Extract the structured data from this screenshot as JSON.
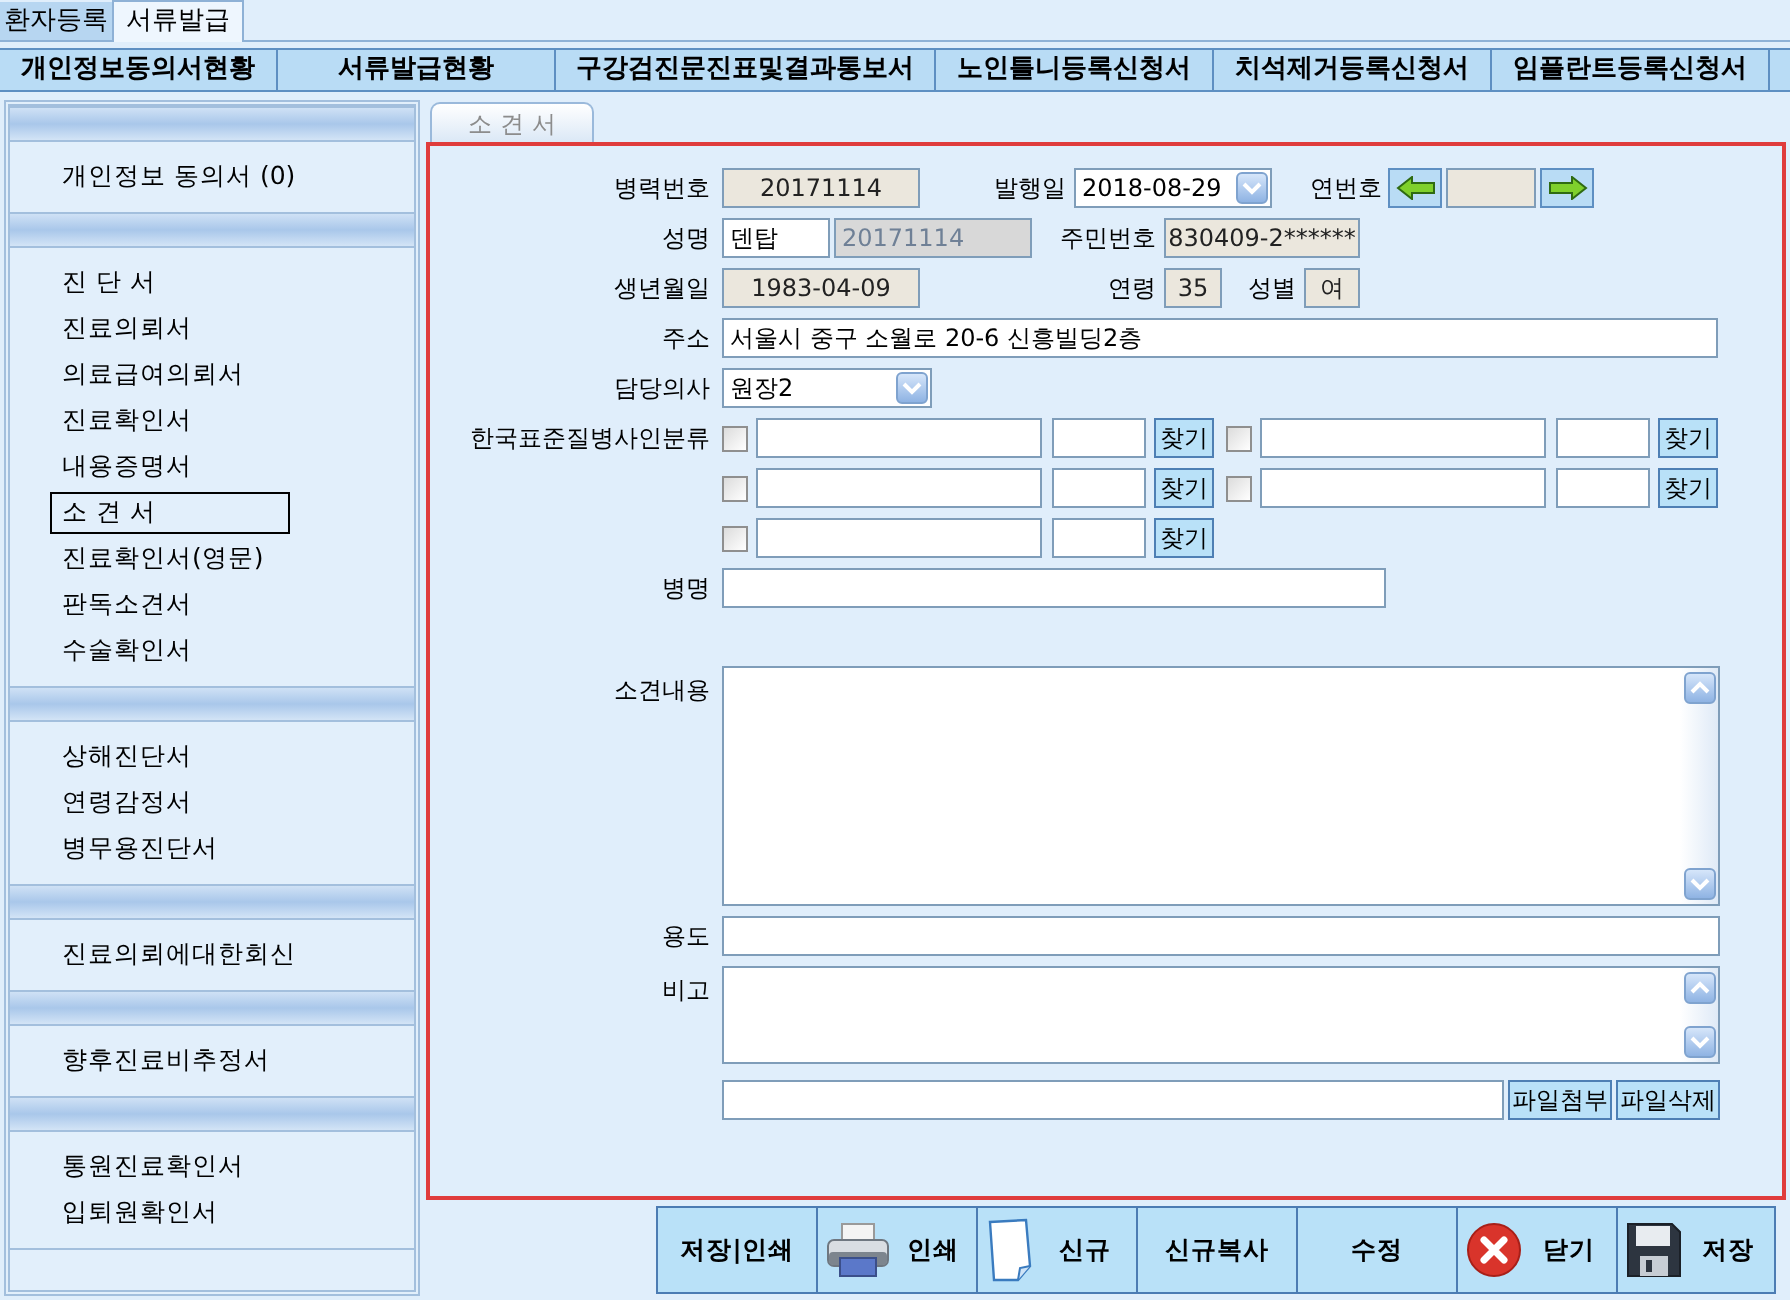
{
  "top_tabs": [
    {
      "label": "환자등록",
      "selected": false
    },
    {
      "label": "서류발급",
      "selected": true
    }
  ],
  "menu_buttons": [
    "개인정보동의서현황",
    "서류발급현황",
    "구강검진문진표및결과통보서",
    "노인틀니등록신청서",
    "치석제거등록신청서",
    "임플란트등록신청서"
  ],
  "sidebar": {
    "sections": [
      {
        "items": [
          {
            "label": "개인정보 동의서 (0)",
            "selected": false
          }
        ]
      },
      {
        "items": [
          {
            "label": "진 단 서",
            "selected": false
          },
          {
            "label": "진료의뢰서",
            "selected": false
          },
          {
            "label": "의료급여의뢰서",
            "selected": false
          },
          {
            "label": "진료확인서",
            "selected": false
          },
          {
            "label": "내용증명서",
            "selected": false
          },
          {
            "label": "소 견 서",
            "selected": true
          },
          {
            "label": "진료확인서(영문)",
            "selected": false
          },
          {
            "label": "판독소견서",
            "selected": false
          },
          {
            "label": "수술확인서",
            "selected": false
          }
        ]
      },
      {
        "items": [
          {
            "label": "상해진단서",
            "selected": false
          },
          {
            "label": "연령감정서",
            "selected": false
          },
          {
            "label": "병무용진단서",
            "selected": false
          }
        ]
      },
      {
        "items": [
          {
            "label": "진료의뢰에대한회신",
            "selected": false
          }
        ]
      },
      {
        "items": [
          {
            "label": "향후진료비추정서",
            "selected": false
          }
        ]
      },
      {
        "items": [
          {
            "label": "통원진료확인서",
            "selected": false
          },
          {
            "label": "입퇴원확인서",
            "selected": false
          }
        ]
      }
    ]
  },
  "form_tab": {
    "label": "소 견 서"
  },
  "form": {
    "registration_no": {
      "label": "병력번호",
      "value": "20171114",
      "readonly": true
    },
    "issue_date": {
      "label": "발행일",
      "value": "2018-08-29"
    },
    "serial_no": {
      "label": "연번호",
      "readonly": true
    },
    "name": {
      "label": "성명",
      "value": "덴탑",
      "readonly": false
    },
    "name_code": {
      "value": "20171114",
      "disabled": true
    },
    "resident_no": {
      "label": "주민번호",
      "value": "830409-2******",
      "readonly": true
    },
    "birth_date": {
      "label": "생년월일",
      "value": "1983-04-09",
      "readonly": true
    },
    "age": {
      "label": "연령",
      "value": "35",
      "readonly": true
    },
    "sex": {
      "label": "성별",
      "value": "여",
      "readonly": true
    },
    "address": {
      "label": "주소",
      "value": "서울시 중구 소월로 20-6 신흥빌딩2층",
      "readonly": false
    },
    "doctor": {
      "label": "담당의사",
      "value": "원장2"
    },
    "disease_codes": {
      "label": "한국표준질병사인분류",
      "entries": [
        {
          "checked": false,
          "button": "찾기"
        },
        {
          "checked": false,
          "button": "찾기"
        },
        {
          "checked": false,
          "button": "찾기"
        },
        {
          "checked": false,
          "button": "찾기"
        },
        {
          "checked": false,
          "button": "찾기"
        }
      ]
    },
    "diagnosis": {
      "label": "병명"
    },
    "opinion": {
      "label": "소견내용"
    },
    "purpose": {
      "label": "용도"
    },
    "remarks": {
      "label": "비고"
    },
    "attachment": {
      "buttons": [
        "파일첨부",
        "파일삭제"
      ]
    }
  },
  "footer_buttons": [
    {
      "label": "저장|인쇄",
      "kind": "plain"
    },
    {
      "label": "인쇄",
      "kind": "print"
    },
    {
      "label": "신규",
      "kind": "new"
    },
    {
      "label": "신규복사",
      "kind": "plain"
    },
    {
      "label": "수정",
      "kind": "plain"
    },
    {
      "label": "닫기",
      "kind": "close"
    },
    {
      "label": "저장",
      "kind": "save"
    }
  ]
}
